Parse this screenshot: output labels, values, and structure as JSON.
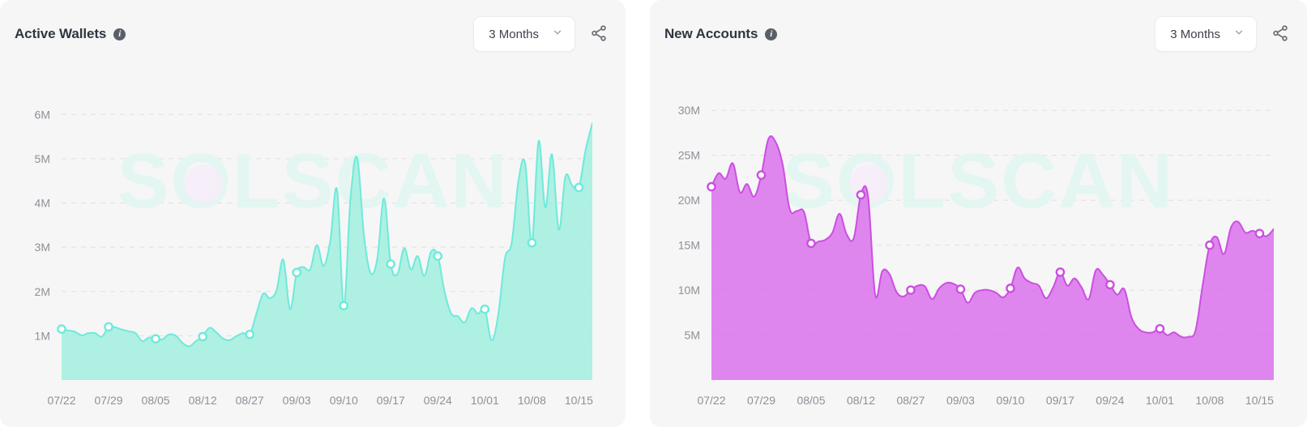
{
  "panels": [
    {
      "id": "active-wallets",
      "title": "Active Wallets",
      "info_icon": "info-icon",
      "range": {
        "label": "3 Months",
        "chevron_icon": "chevron-down-icon"
      },
      "share": {
        "icon": "share-icon",
        "label": "Share"
      },
      "accent": "#6eeadb",
      "fill": "#a7efe0",
      "watermark": "SOLSCAN",
      "chart_data": {
        "type": "area",
        "title": "Active Wallets",
        "xlabel": "",
        "ylabel": "",
        "ylim": [
          0,
          6500000
        ],
        "grid": true,
        "legend": "none",
        "ytick_labels": [
          "1M",
          "2M",
          "3M",
          "4M",
          "5M",
          "6M"
        ],
        "ytick_values": [
          1000000,
          2000000,
          3000000,
          4000000,
          5000000,
          6000000
        ],
        "xtick_labels": [
          "07/22",
          "07/29",
          "08/05",
          "08/12",
          "08/27",
          "09/03",
          "09/10",
          "09/17",
          "09/24",
          "10/01",
          "10/08",
          "10/15"
        ],
        "xtick_indices": [
          0,
          7,
          14,
          21,
          28,
          35,
          42,
          49,
          56,
          63,
          70,
          77
        ],
        "marker_indices": [
          0,
          7,
          14,
          21,
          28,
          35,
          42,
          49,
          56,
          63,
          70,
          77
        ],
        "values": [
          1150000,
          1120000,
          1090000,
          1010000,
          1060000,
          1060000,
          980000,
          1200000,
          1190000,
          1140000,
          1100000,
          1060000,
          880000,
          960000,
          930000,
          920000,
          1030000,
          1000000,
          840000,
          760000,
          880000,
          980000,
          1180000,
          1080000,
          940000,
          900000,
          990000,
          1060000,
          1030000,
          1500000,
          1950000,
          1850000,
          2030000,
          2720000,
          1600000,
          2430000,
          2550000,
          2500000,
          3050000,
          2580000,
          3150000,
          4300000,
          1680000,
          4100000,
          5020000,
          3280000,
          2420000,
          2750000,
          4100000,
          2620000,
          2400000,
          2980000,
          2500000,
          2800000,
          2350000,
          2900000,
          2800000,
          2000000,
          1500000,
          1440000,
          1300000,
          1620000,
          1500000,
          1600000,
          900000,
          1480000,
          2750000,
          3100000,
          4500000,
          4900000,
          3100000,
          5400000,
          3900000,
          5100000,
          3400000,
          4600000,
          4400000,
          4350000,
          5200000,
          5800000
        ]
      }
    },
    {
      "id": "new-accounts",
      "title": "New Accounts",
      "info_icon": "info-icon",
      "range": {
        "label": "3 Months",
        "chevron_icon": "chevron-down-icon"
      },
      "share": {
        "icon": "share-icon",
        "label": "Share"
      },
      "accent": "#cb4fe0",
      "fill": "#d86ceb",
      "watermark": "SOLSCAN",
      "chart_data": {
        "type": "area",
        "title": "New Accounts",
        "xlabel": "",
        "ylabel": "",
        "ylim": [
          0,
          32000000
        ],
        "grid": true,
        "legend": "none",
        "ytick_labels": [
          "5M",
          "10M",
          "15M",
          "20M",
          "25M",
          "30M"
        ],
        "ytick_values": [
          5000000,
          10000000,
          15000000,
          20000000,
          25000000,
          30000000
        ],
        "xtick_labels": [
          "07/22",
          "07/29",
          "08/05",
          "08/12",
          "08/27",
          "09/03",
          "09/10",
          "09/17",
          "09/24",
          "10/01",
          "10/08",
          "10/15"
        ],
        "xtick_indices": [
          0,
          7,
          14,
          21,
          28,
          35,
          42,
          49,
          56,
          63,
          70,
          77
        ],
        "marker_indices": [
          0,
          7,
          14,
          21,
          28,
          35,
          42,
          49,
          56,
          63,
          70,
          77
        ],
        "values": [
          21500000,
          23000000,
          22400000,
          24100000,
          20900000,
          21800000,
          20400000,
          22800000,
          26800000,
          26500000,
          24000000,
          19000000,
          18800000,
          18700000,
          15200000,
          15400000,
          15600000,
          16400000,
          18500000,
          16200000,
          15800000,
          20600000,
          20400000,
          9500000,
          12100000,
          11800000,
          9800000,
          9300000,
          10000000,
          10500000,
          10400000,
          9000000,
          10200000,
          10800000,
          10700000,
          10100000,
          8600000,
          9700000,
          10000000,
          10000000,
          9700000,
          9200000,
          10200000,
          12500000,
          11300000,
          10800000,
          10500000,
          9100000,
          10300000,
          12000000,
          10500000,
          11300000,
          10300000,
          9000000,
          12200000,
          11700000,
          10600000,
          9500000,
          10100000,
          7000000,
          5700000,
          5300000,
          5300000,
          5700000,
          5000000,
          5300000,
          4800000,
          4800000,
          5500000,
          10500000,
          15000000,
          15900000,
          14000000,
          17000000,
          17600000,
          16400000,
          16600000,
          16300000,
          16000000,
          16800000
        ]
      }
    }
  ]
}
